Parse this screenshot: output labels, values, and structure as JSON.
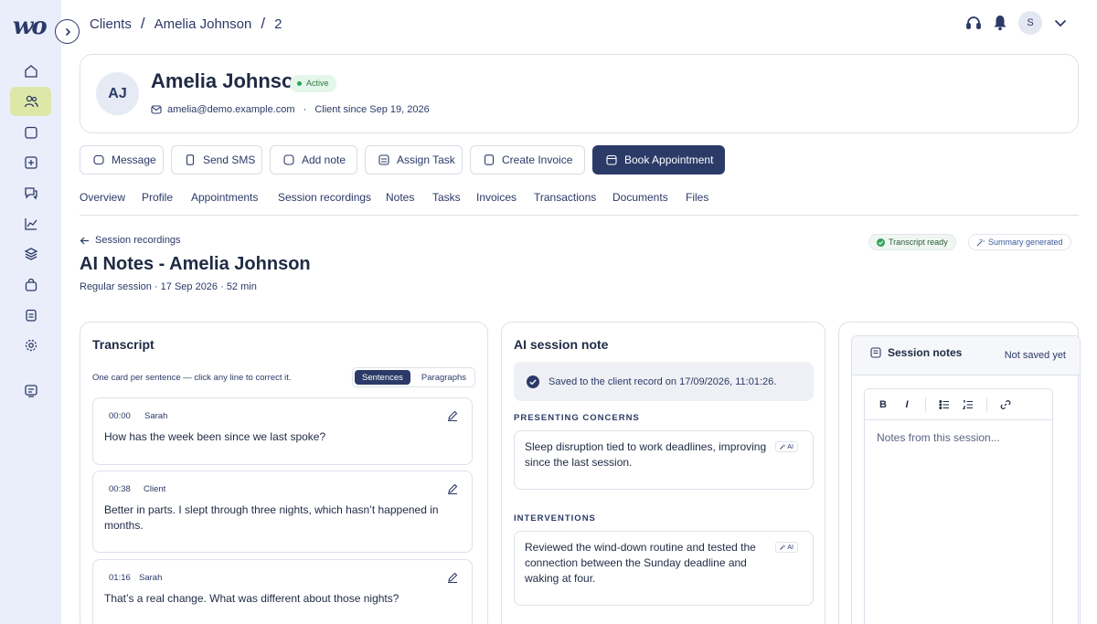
{
  "app": {
    "logo": "wo"
  },
  "breadcrumb": [
    "Clients",
    "Amelia Johnson",
    "2"
  ],
  "user": {
    "initial": "S"
  },
  "client": {
    "initials": "AJ",
    "name": "Amelia Johnson",
    "status": "Active",
    "email": "amelia@demo.example.com",
    "since": "Client since Sep 19, 2026"
  },
  "actions": {
    "message": "Message",
    "send_sms": "Send SMS",
    "add_note": "Add note",
    "assign_task": "Assign Task",
    "create_invoice": "Create Invoice",
    "book_appointment": "Book Appointment"
  },
  "tabs": [
    "Overview",
    "Profile",
    "Appointments",
    "Session recordings",
    "Notes",
    "Tasks",
    "Invoices",
    "Transactions",
    "Documents",
    "Files"
  ],
  "session": {
    "back_label": "Session recordings",
    "title": "AI Notes - Amelia Johnson",
    "meta": "Regular session · 17 Sep 2026 · 52 min",
    "transcript_ready": "Transcript ready",
    "summary_generated": "Summary generated"
  },
  "transcript": {
    "title": "Transcript",
    "hint": "One card per sentence — click any line to correct it.",
    "toggle": [
      "Sentences",
      "Paragraphs"
    ],
    "lines": [
      {
        "time": "00:00",
        "speaker": "Sarah",
        "text": "How has the week been since we last spoke?"
      },
      {
        "time": "00:38",
        "speaker": "Client",
        "text": "Better in parts. I slept through three nights, which hasn’t happened in months."
      },
      {
        "time": "01:16",
        "speaker": "Sarah",
        "text": "That’s a real change. What was different about those nights?"
      }
    ]
  },
  "ai_note": {
    "title": "AI session note",
    "saved": "Saved to the client record on 17/09/2026, 11:01:26.",
    "ai_tag": "AI",
    "sections": [
      {
        "label": "PRESENTING CONCERNS",
        "text": "Sleep disruption tied to work deadlines, improving since the last session."
      },
      {
        "label": "INTERVENTIONS",
        "text": "Reviewed the wind-down routine and tested the connection between the Sunday deadline and waking at four."
      }
    ]
  },
  "session_notes": {
    "title": "Session notes",
    "status": "Not saved yet",
    "toolbar": {
      "bold": "B",
      "italic": "I"
    },
    "placeholder": "Notes from this session..."
  }
}
